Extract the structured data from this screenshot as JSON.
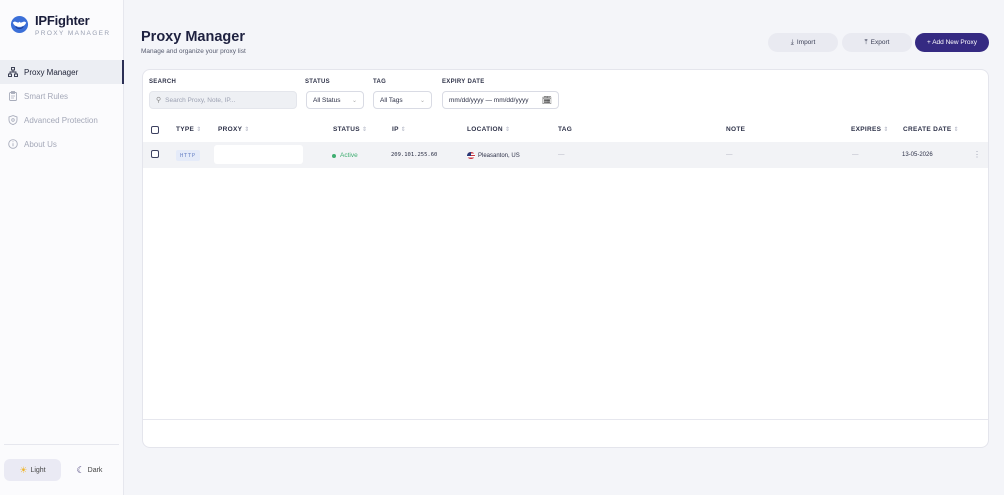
{
  "app": {
    "name": "IPFighter",
    "subtitle": "PROXY MANAGER"
  },
  "sidebar": {
    "items": [
      {
        "label": "Proxy Manager",
        "icon": "sitemap-icon",
        "active": true
      },
      {
        "label": "Smart Rules",
        "icon": "clipboard-icon",
        "active": false
      },
      {
        "label": "Advanced Protection",
        "icon": "shield-icon",
        "active": false
      },
      {
        "label": "About Us",
        "icon": "info-icon",
        "active": false
      }
    ],
    "theme": {
      "light_label": "Light",
      "dark_label": "Dark",
      "selected": "Light"
    }
  },
  "header": {
    "title": "Proxy Manager",
    "subtitle": "Manage and organize your proxy list",
    "import_label": "Import",
    "export_label": "Export",
    "add_label": "+ Add New Proxy"
  },
  "filters": {
    "search_label": "SEARCH",
    "search_placeholder": "Search Proxy, Note, IP...",
    "status_label": "STATUS",
    "status_value": "All Status",
    "tag_label": "TAG",
    "tag_value": "All Tags",
    "expiry_label": "EXPIRY DATE",
    "expiry_value": "mm/dd/yyyy — mm/dd/yyyy"
  },
  "table": {
    "columns": {
      "type": "TYPE",
      "proxy": "PROXY",
      "status": "STATUS",
      "ip": "IP",
      "location": "LOCATION",
      "tag": "TAG",
      "note": "NOTE",
      "expires": "EXPIRES",
      "create_date": "CREATE DATE"
    },
    "rows": [
      {
        "type": "HTTP",
        "proxy": "",
        "status": "Active",
        "ip": "209.101.255.60",
        "location": "Pleasanton, US",
        "tag": "—",
        "note": "—",
        "expires": "—",
        "create_date": "13-05-2026"
      }
    ]
  },
  "colors": {
    "accent": "#352a82",
    "active_status": "#3fae71",
    "badge_bg": "#e5ebf9",
    "badge_text": "#6f87c8"
  }
}
